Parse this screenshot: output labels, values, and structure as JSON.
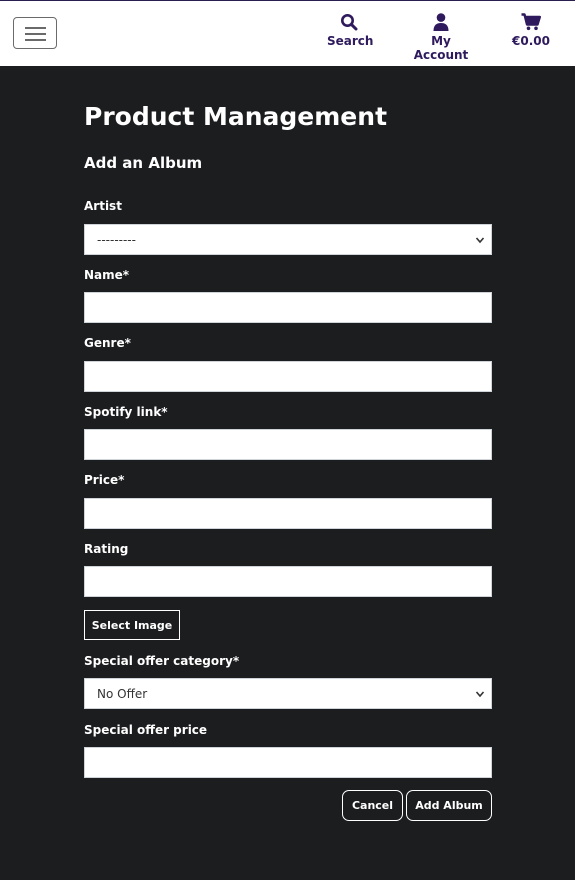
{
  "nav": {
    "search_label": "Search",
    "account_label": "My Account",
    "cart_total": "€0.00",
    "menu_icon": "hamburger-icon",
    "search_icon": "search-icon",
    "account_icon": "user-icon",
    "cart_icon": "cart-icon",
    "brand_color": "#2e1a5c"
  },
  "page": {
    "title": "Product Management",
    "subtitle": "Add an Album"
  },
  "form": {
    "artist": {
      "label": "Artist",
      "value": "---------"
    },
    "name": {
      "label": "Name*",
      "value": ""
    },
    "genre": {
      "label": "Genre*",
      "value": ""
    },
    "spotify": {
      "label": "Spotify link*",
      "value": ""
    },
    "price": {
      "label": "Price*",
      "value": ""
    },
    "rating": {
      "label": "Rating",
      "value": ""
    },
    "select_image_label": "Select Image",
    "offer_category": {
      "label": "Special offer category*",
      "value": "No Offer"
    },
    "offer_price": {
      "label": "Special offer price",
      "value": ""
    },
    "cancel_label": "Cancel",
    "submit_label": "Add Album"
  }
}
